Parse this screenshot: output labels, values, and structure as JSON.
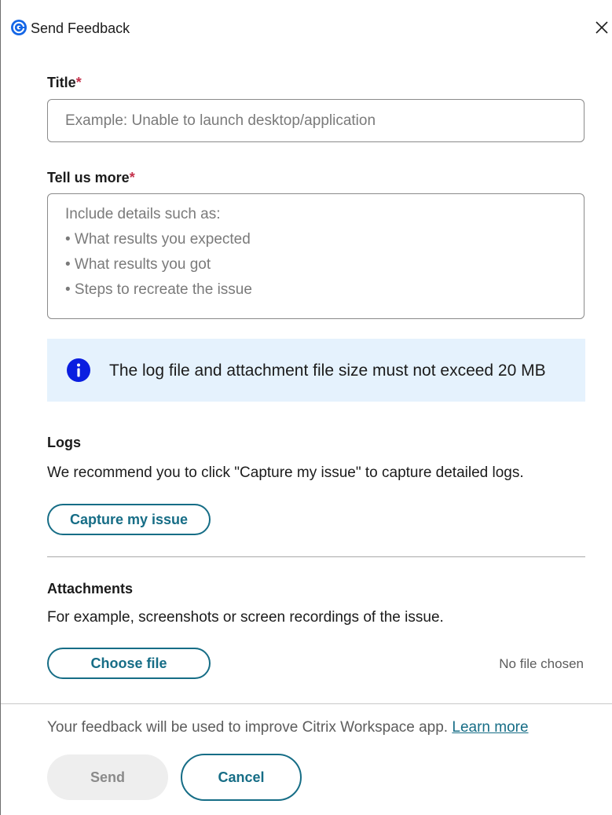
{
  "window": {
    "title": "Send Feedback",
    "logo_icon": "citrix-logo-icon",
    "close_icon": "close-icon"
  },
  "title_field": {
    "label": "Title",
    "required_mark": "*",
    "placeholder": "Example: Unable to launch desktop/application",
    "value": ""
  },
  "details_field": {
    "label": "Tell us more",
    "required_mark": "*",
    "placeholder_lines": [
      "Include details such as:",
      "• What results you expected",
      "• What results you got",
      "• Steps to recreate the issue"
    ]
  },
  "info_banner": {
    "icon": "info-icon",
    "text": "The log file and attachment file size must not exceed 20 MB"
  },
  "logs": {
    "heading": "Logs",
    "description": "We recommend you to click \"Capture my issue\" to capture detailed logs.",
    "button_label": "Capture my issue"
  },
  "attachments": {
    "heading": "Attachments",
    "description": "For example, screenshots or screen recordings of the issue.",
    "button_label": "Choose file",
    "status": "No file chosen"
  },
  "footer": {
    "text": "Your feedback will be used to improve Citrix Workspace app.",
    "link_label": "Learn more",
    "send_label": "Send",
    "cancel_label": "Cancel"
  },
  "colors": {
    "accent": "#166d86",
    "required": "#c4314b",
    "info_background": "#e5f2fd",
    "info_icon": "#0a1ee0",
    "logo": "#1466e6",
    "disabled_button": "#eeeeee"
  }
}
